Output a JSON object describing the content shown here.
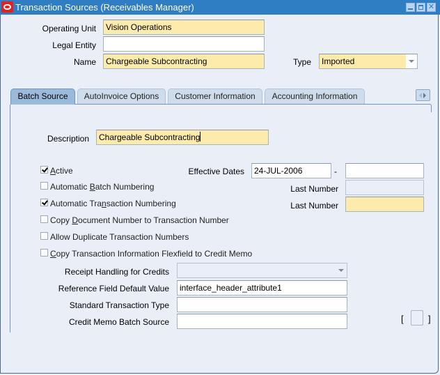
{
  "window": {
    "title": "Transaction Sources (Receivables Manager)",
    "controls": [
      "minimize",
      "maximize",
      "close"
    ]
  },
  "header": {
    "operating_unit": {
      "label": "Operating Unit",
      "value": "Vision Operations"
    },
    "legal_entity": {
      "label": "Legal Entity",
      "value": ""
    },
    "name": {
      "label": "Name",
      "value": "Chargeable Subcontracting"
    },
    "type": {
      "label": "Type",
      "value": "Imported"
    }
  },
  "tabs": [
    {
      "label": "Batch Source",
      "active": true
    },
    {
      "label": "AutoInvoice Options",
      "active": false
    },
    {
      "label": "Customer Information",
      "active": false
    },
    {
      "label": "Accounting Information",
      "active": false
    }
  ],
  "batch_source": {
    "description": {
      "label": "Description",
      "value": "Chargeable Subcontracting"
    },
    "effective_dates": {
      "label": "Effective Dates",
      "from": "24-JUL-2006",
      "separator": "-",
      "to": ""
    },
    "checkboxes": [
      {
        "pre": "",
        "mnemonic": "A",
        "post": "ctive",
        "checked": true
      },
      {
        "pre": "Automatic ",
        "mnemonic": "B",
        "post": "atch Numbering",
        "checked": false
      },
      {
        "pre": "Automatic Tra",
        "mnemonic": "n",
        "post": "saction Numbering",
        "checked": true
      },
      {
        "pre": "Copy ",
        "mnemonic": "D",
        "post": "ocument Number to Transaction Number",
        "checked": false
      },
      {
        "pre": "Allow Duplicate Transaction Numbers",
        "mnemonic": "",
        "post": "",
        "checked": false
      },
      {
        "pre": "",
        "mnemonic": "C",
        "post": "opy Transaction Information Flexfield to Credit Memo",
        "checked": false
      }
    ],
    "last_number_batch": {
      "label": "Last Number",
      "value": ""
    },
    "last_number_trx": {
      "label": "Last Number",
      "value": ""
    },
    "receipt_handling": {
      "label": "Receipt Handling for Credits",
      "value": ""
    },
    "reference_field": {
      "label": "Reference Field Default Value",
      "value": "interface_header_attribute1"
    },
    "standard_trx_type": {
      "label": "Standard Transaction Type",
      "value": ""
    },
    "credit_memo_batch_source": {
      "label": "Credit Memo Batch Source",
      "value": ""
    },
    "flexfield": {
      "open": "[",
      "close": "]"
    }
  }
}
